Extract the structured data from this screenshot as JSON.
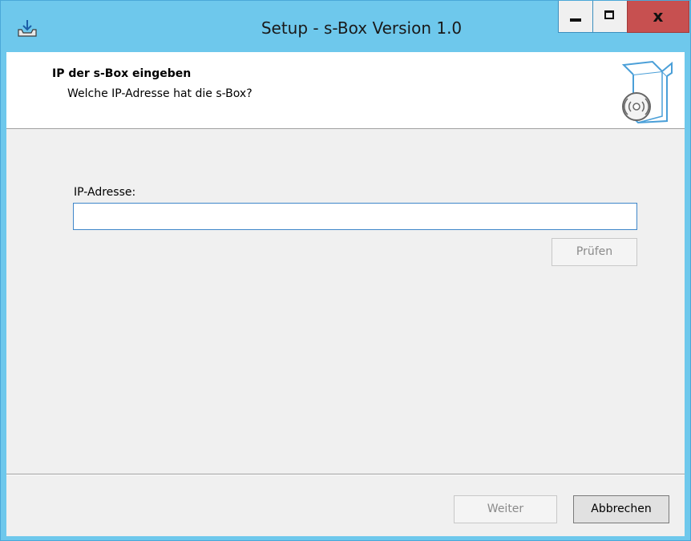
{
  "window": {
    "title": "Setup - s-Box Version 1.0",
    "close_glyph": "x"
  },
  "header": {
    "title": "IP der s-Box eingeben",
    "subtitle": "Welche IP-Adresse hat die s-Box?",
    "icon": "software-box-disc-icon"
  },
  "form": {
    "ip_label": "IP-Adresse:",
    "ip_value": "",
    "check_button": "Prüfen"
  },
  "footer": {
    "next_button": "Weiter",
    "cancel_button": "Abbrechen"
  },
  "colors": {
    "titlebar": "#6ec8ec",
    "close_button": "#c75050",
    "input_focus_border": "#3f86c9"
  }
}
